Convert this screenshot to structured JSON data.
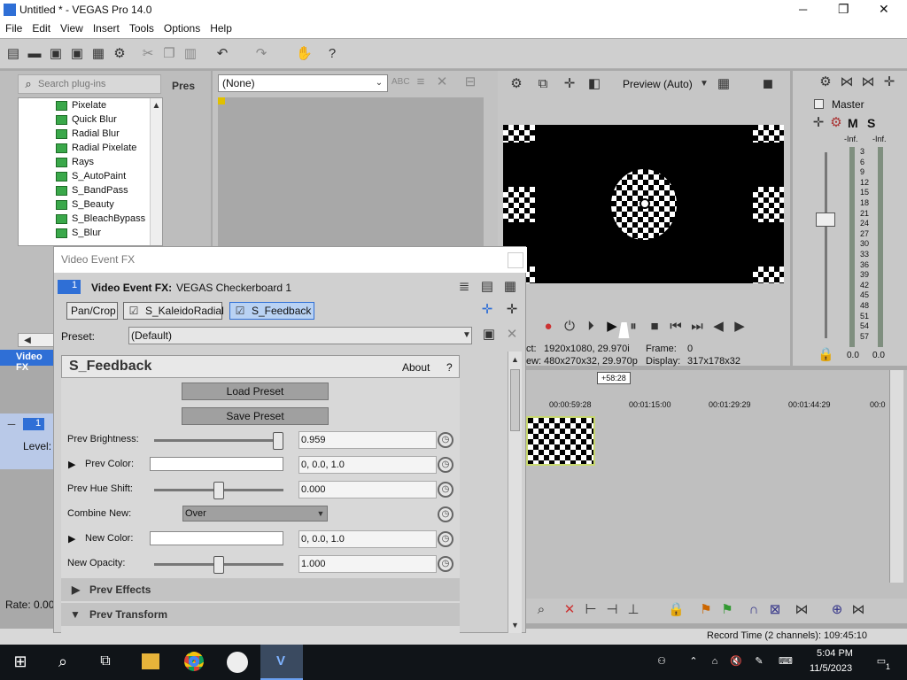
{
  "window": {
    "title": "Untitled * - VEGAS Pro 14.0",
    "minimize": "─",
    "maximize": "❐",
    "close": "✕"
  },
  "menu": [
    "File",
    "Edit",
    "View",
    "Insert",
    "Tools",
    "Options",
    "Help"
  ],
  "plugins": {
    "search_placeholder": "Search plug-ins",
    "presets_tab": "Pres",
    "tab_label": "Video FX",
    "items": [
      "Pixelate",
      "Quick Blur",
      "Radial Blur",
      "Radial Pixelate",
      "Rays",
      "S_AutoPaint",
      "S_BandPass",
      "S_Beauty",
      "S_BleachBypass",
      "S_Blur"
    ]
  },
  "trimmer": {
    "selector": "(None)"
  },
  "preview": {
    "mode": "Preview (Auto)",
    "project_label": "ct:",
    "project_value": "1920x1080, 29.970i",
    "preview_label": "ew:",
    "preview_value": "480x270x32, 29.970p",
    "frame_label": "Frame:",
    "frame_value": "0",
    "display_label": "Display:",
    "display_value": "317x178x32"
  },
  "master": {
    "label": "Master",
    "m": "M",
    "s": "S",
    "inf_left": "-Inf.",
    "inf_right": "-Inf.",
    "scale": [
      "3",
      "6",
      "9",
      "12",
      "15",
      "18",
      "21",
      "24",
      "27",
      "30",
      "33",
      "36",
      "39",
      "42",
      "45",
      "48",
      "51",
      "54",
      "57"
    ],
    "bottom_left": "0.0",
    "bottom_right": "0.0"
  },
  "dialog": {
    "title": "Video Event FX",
    "track_num": "1",
    "header": "Video Event FX:",
    "media": "VEGAS Checkerboard 1",
    "chain": [
      "Pan/Crop",
      "S_KaleidoRadial",
      "S_Feedback"
    ],
    "preset_label": "Preset:",
    "preset_value": "(Default)",
    "plugin_name": "S_Feedback",
    "about": "About",
    "help": "?",
    "load_preset": "Load Preset",
    "save_preset": "Save Preset",
    "params": [
      {
        "label": "Prev Brightness:",
        "value": "0.959",
        "slider": 1.0
      },
      {
        "label": "Prev Color:",
        "value": "0, 0.0, 1.0"
      },
      {
        "label": "Prev Hue Shift:",
        "value": "0.000",
        "slider": 0.5
      },
      {
        "label": "Combine New:",
        "value": "Over"
      },
      {
        "label": "New Color:",
        "value": "0, 0.0, 1.0"
      },
      {
        "label": "New Opacity:",
        "value": "1.000",
        "slider": 0.5
      }
    ],
    "sections": [
      "Prev Effects",
      "Prev Transform"
    ]
  },
  "track": {
    "number": "1",
    "level_label": "Level:"
  },
  "timeline": {
    "cursor_tag": "+58:28",
    "ticks": [
      "00:00:59:28",
      "00:01:15:00",
      "00:01:29:29",
      "00:01:44:29",
      "00:0"
    ]
  },
  "status": {
    "rate": "Rate: 0.00",
    "record_time": "Record Time (2 channels): 109:45:10"
  },
  "taskbar": {
    "time": "5:04 PM",
    "date": "11/5/2023",
    "notif": "1"
  },
  "colors": {
    "accent": "#2f6fd6",
    "selected_tab": "#b9d2f3",
    "plugin_icon": "#3aa84a"
  }
}
